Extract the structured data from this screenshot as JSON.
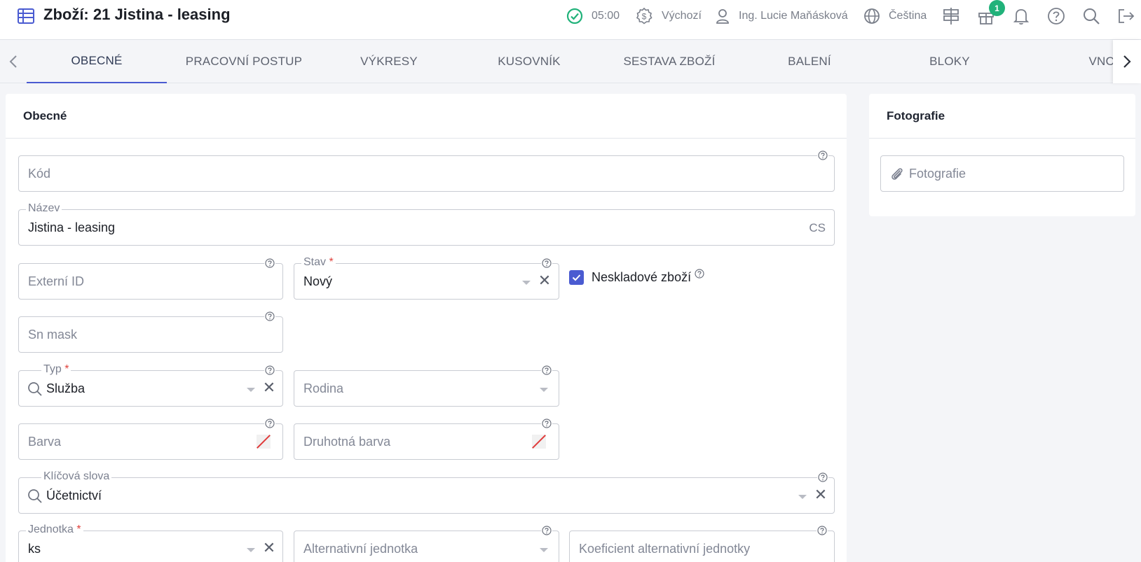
{
  "header": {
    "title": "Zboží: 21 Jistina - leasing",
    "time": "05:00",
    "currency_profile": "Výchozí",
    "user": "Ing. Lucie Maňásková",
    "language": "Čeština",
    "gift_badge": "1",
    "icons": [
      "table-icon",
      "check-circle-icon",
      "dollar-icon",
      "user-icon",
      "globe-icon",
      "signpost-icon",
      "gift-icon",
      "bell-icon",
      "help-icon",
      "search-icon",
      "logout-icon"
    ]
  },
  "tabs": [
    "OBECNÉ",
    "PRACOVNÍ POSTUP",
    "VÝKRESY",
    "KUSOVNÍK",
    "SESTAVA ZBOŽÍ",
    "BALENÍ",
    "BLOKY",
    "VNC"
  ],
  "main": {
    "title": "Obecné",
    "fields": {
      "kod": {
        "placeholder": "Kód"
      },
      "nazev": {
        "label": "Název",
        "value": "Jistina - leasing",
        "suffix": "CS"
      },
      "externi_id": {
        "placeholder": "Externí ID"
      },
      "stav": {
        "label": "Stav",
        "required": "*",
        "value": "Nový"
      },
      "neskladove": {
        "label": "Neskladové zboží",
        "checked": true
      },
      "sn_mask": {
        "placeholder": "Sn mask"
      },
      "typ": {
        "label": "Typ",
        "required": "*",
        "value": "Služba"
      },
      "rodina": {
        "placeholder": "Rodina"
      },
      "barva": {
        "placeholder": "Barva"
      },
      "druhotna_barva": {
        "placeholder": "Druhotná barva"
      },
      "klicova_slova": {
        "label": "Klíčová slova",
        "value": "Účetnictví"
      },
      "jednotka": {
        "label": "Jednotka",
        "required": "*",
        "value": "ks"
      },
      "alt_jednotka": {
        "placeholder": "Alternativní jednotka"
      },
      "koef_alt": {
        "placeholder": "Koeficient alternativní jednotky"
      }
    }
  },
  "photo": {
    "title": "Fotografie",
    "field_placeholder": "Fotografie"
  },
  "colors": {
    "accent": "#4a5bd1",
    "success": "#21b27a",
    "required": "#e0423d"
  }
}
